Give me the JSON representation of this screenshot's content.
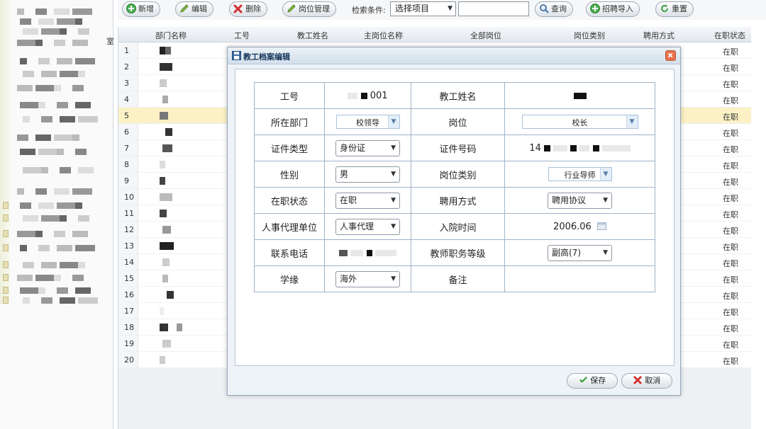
{
  "toolbar": {
    "add_label": "新增",
    "edit_label": "编辑",
    "delete_label": "删除",
    "post_manage_label": "岗位管理",
    "search_condition_label": "检索条件:",
    "search_select_value": "选择项目",
    "query_label": "查询",
    "import_label": "招聘导入",
    "reset_label": "重置"
  },
  "left_panel": {
    "side_label": "室"
  },
  "grid": {
    "columns": [
      "部门名称",
      "工号",
      "教工姓名",
      "主岗位名称",
      "全部岗位",
      "岗位类别",
      "聘用方式",
      "在职状态"
    ],
    "rows": [
      {
        "no": "1",
        "status": "在职"
      },
      {
        "no": "2",
        "status": "在职"
      },
      {
        "no": "3",
        "status": "在职"
      },
      {
        "no": "4",
        "status": "在职"
      },
      {
        "no": "5",
        "status": "在职"
      },
      {
        "no": "6",
        "status": "在职"
      },
      {
        "no": "7",
        "status": "在职"
      },
      {
        "no": "8",
        "status": "在职"
      },
      {
        "no": "9",
        "status": "在职"
      },
      {
        "no": "10",
        "status": "在职"
      },
      {
        "no": "11",
        "status": "在职"
      },
      {
        "no": "12",
        "status": "在职"
      },
      {
        "no": "13",
        "status": "在职"
      },
      {
        "no": "14",
        "status": "在职"
      },
      {
        "no": "15",
        "status": "在职"
      },
      {
        "no": "16",
        "status": "在职"
      },
      {
        "no": "17",
        "status": "在职"
      },
      {
        "no": "18",
        "status": "在职"
      },
      {
        "no": "19",
        "status": "在职"
      },
      {
        "no": "20",
        "status": "在职"
      }
    ]
  },
  "dialog": {
    "title": "教工档案编辑",
    "labels": {
      "staff_no": "工号",
      "name": "教工姓名",
      "department": "所在部门",
      "post": "岗位",
      "id_type": "证件类型",
      "id_no": "证件号码",
      "gender": "性别",
      "post_category": "岗位类别",
      "status": "在职状态",
      "employment": "聘用方式",
      "agent_unit": "人事代理单位",
      "entry_date": "入院时间",
      "phone": "联系电话",
      "teacher_grade": "教师职务等级",
      "education": "学缘",
      "remark": "备注"
    },
    "values": {
      "staff_no_suffix": "001",
      "department": "校领导",
      "post": "校长",
      "id_type": "身份证",
      "id_no_prefix": "14",
      "gender": "男",
      "post_category": "行业导师",
      "status": "在职",
      "employment": "聘用协议",
      "agent_unit": "人事代理",
      "entry_date": "2006.06",
      "teacher_grade": "副高(7)",
      "education": "海外",
      "remark": ""
    },
    "save_label": "保存",
    "cancel_label": "取消"
  },
  "colors": {
    "selected_row": "#fbf1c4",
    "dialog_border": "#95a7bb",
    "form_border": "#9fb3c9",
    "close_button": "#e8734f"
  }
}
